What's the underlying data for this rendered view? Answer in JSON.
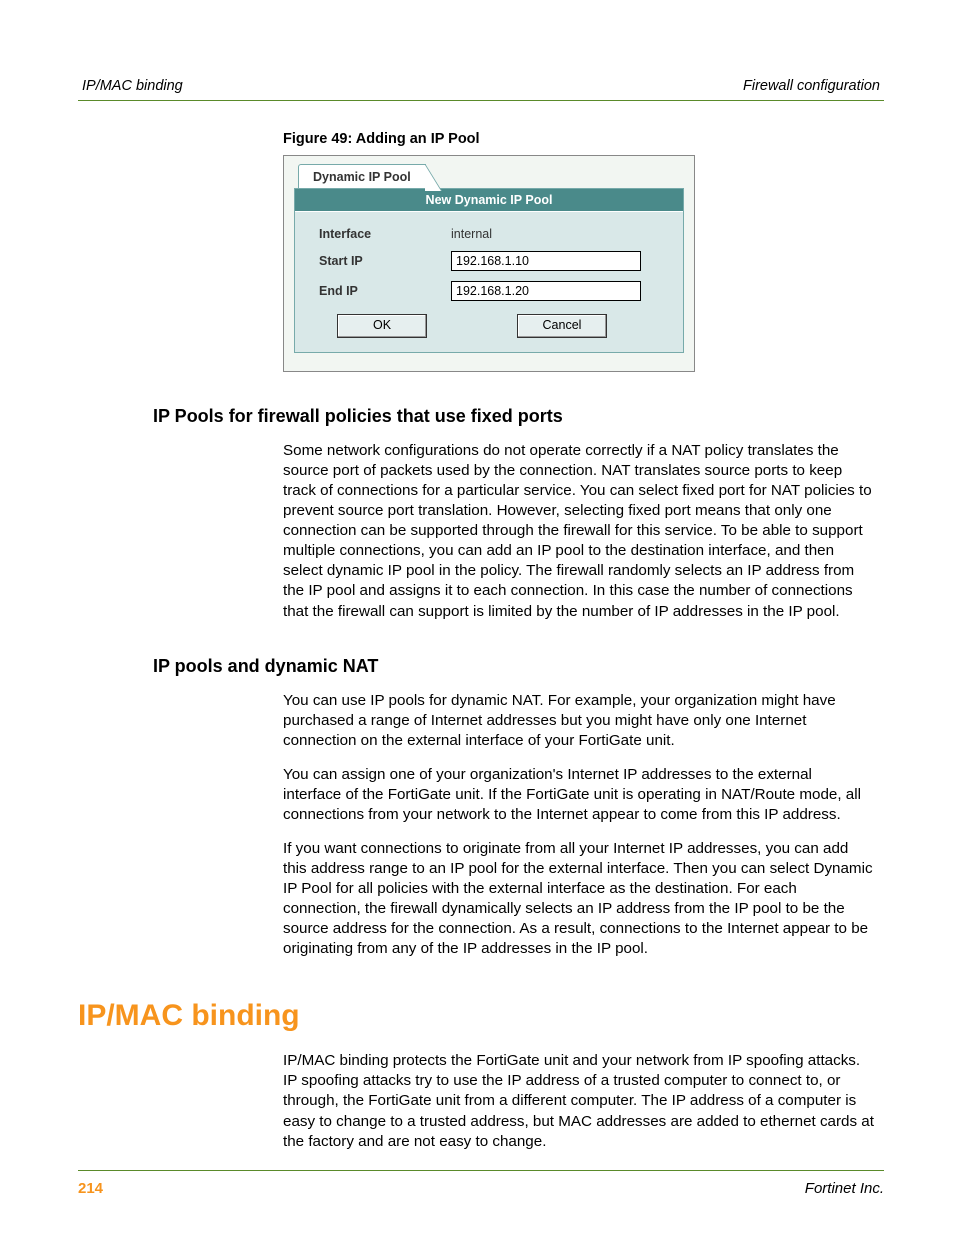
{
  "header": {
    "left": "IP/MAC binding",
    "right": "Firewall configuration"
  },
  "figure": {
    "caption": "Figure 49: Adding an IP Pool",
    "tab_label": "Dynamic IP Pool",
    "panel_title": "New Dynamic IP Pool",
    "rows": {
      "interface_label": "Interface",
      "interface_value": "internal",
      "startip_label": "Start IP",
      "startip_value": "192.168.1.10",
      "endip_label": "End IP",
      "endip_value": "192.168.1.20"
    },
    "ok_label": "OK",
    "cancel_label": "Cancel"
  },
  "sections": {
    "s1_title": "IP Pools for firewall policies that use fixed ports",
    "s1_p1": "Some network configurations do not operate correctly if a NAT policy translates the source port of packets used by the connection. NAT translates source ports to keep track of connections for a particular service. You can select fixed port for NAT policies to prevent source port translation. However, selecting fixed port means that only one connection can be supported through the firewall for this service. To be able to support multiple connections, you can add an IP pool to the destination interface, and then select dynamic IP pool in the policy. The firewall randomly selects an IP address from the IP pool and assigns it to each connection. In this case the number of connections that the firewall can support is limited by the number of IP addresses in the IP pool.",
    "s2_title": "IP pools and dynamic NAT",
    "s2_p1": "You can use IP pools for dynamic NAT. For example, your organization might have purchased a range of Internet addresses but you might have only one Internet connection on the external interface of your FortiGate unit.",
    "s2_p2": "You can assign one of your organization's Internet IP addresses to the external interface of the FortiGate unit. If the FortiGate unit is operating in NAT/Route mode, all connections from your network to the Internet appear to come from this IP address.",
    "s2_p3": "If you want connections to originate from all your Internet IP addresses, you can add this address range to an IP pool for the external interface. Then you can select Dynamic IP Pool for all policies with the external interface as the destination. For each connection, the firewall dynamically selects an IP address from the IP pool to be the source address for the connection. As a result, connections to the Internet appear to be originating from any of the IP addresses in the IP pool."
  },
  "h1": "IP/MAC binding",
  "h1_p1": "IP/MAC binding protects the FortiGate unit and your network from IP spoofing attacks. IP spoofing attacks try to use the IP address of a trusted computer to connect to, or through, the FortiGate unit from a different computer. The IP address of a computer is easy to change to a trusted address, but MAC addresses are added to ethernet cards at the factory and are not easy to change.",
  "footer": {
    "page": "214",
    "company": "Fortinet Inc."
  }
}
